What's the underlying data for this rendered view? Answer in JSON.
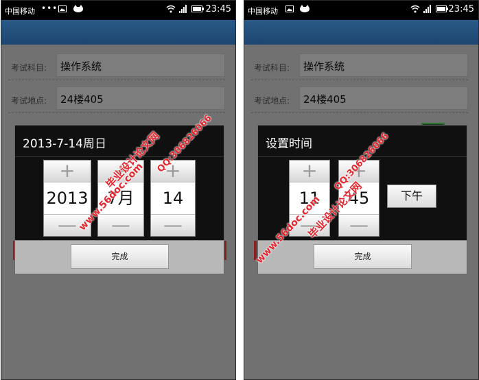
{
  "status_bar": {
    "carrier": "中国移动",
    "notif_dots": "•••",
    "time": "23:45"
  },
  "form": {
    "subject_label": "考试科目:",
    "subject_value": "操作系统",
    "location_label": "考试地点:",
    "location_value": "24楼405",
    "date_partial": "2013-7-14"
  },
  "date_dialog": {
    "title": "2013-7-14周日",
    "plus": "+",
    "minus": "—",
    "year": "2013",
    "month": "7月",
    "day": "14",
    "done": "完成"
  },
  "time_dialog": {
    "title": "设置时间",
    "plus": "+",
    "minus": "—",
    "hour": "11",
    "minute": "45",
    "ampm": "下午",
    "done": "完成"
  },
  "watermark": {
    "site": "www.56doc.com",
    "qq": "QQ:306826066",
    "name": "毕业设计论文网"
  },
  "colors": {
    "action_bar": "#1d4670",
    "watermark": "#e6262e",
    "dialog_bg": "#101010"
  }
}
